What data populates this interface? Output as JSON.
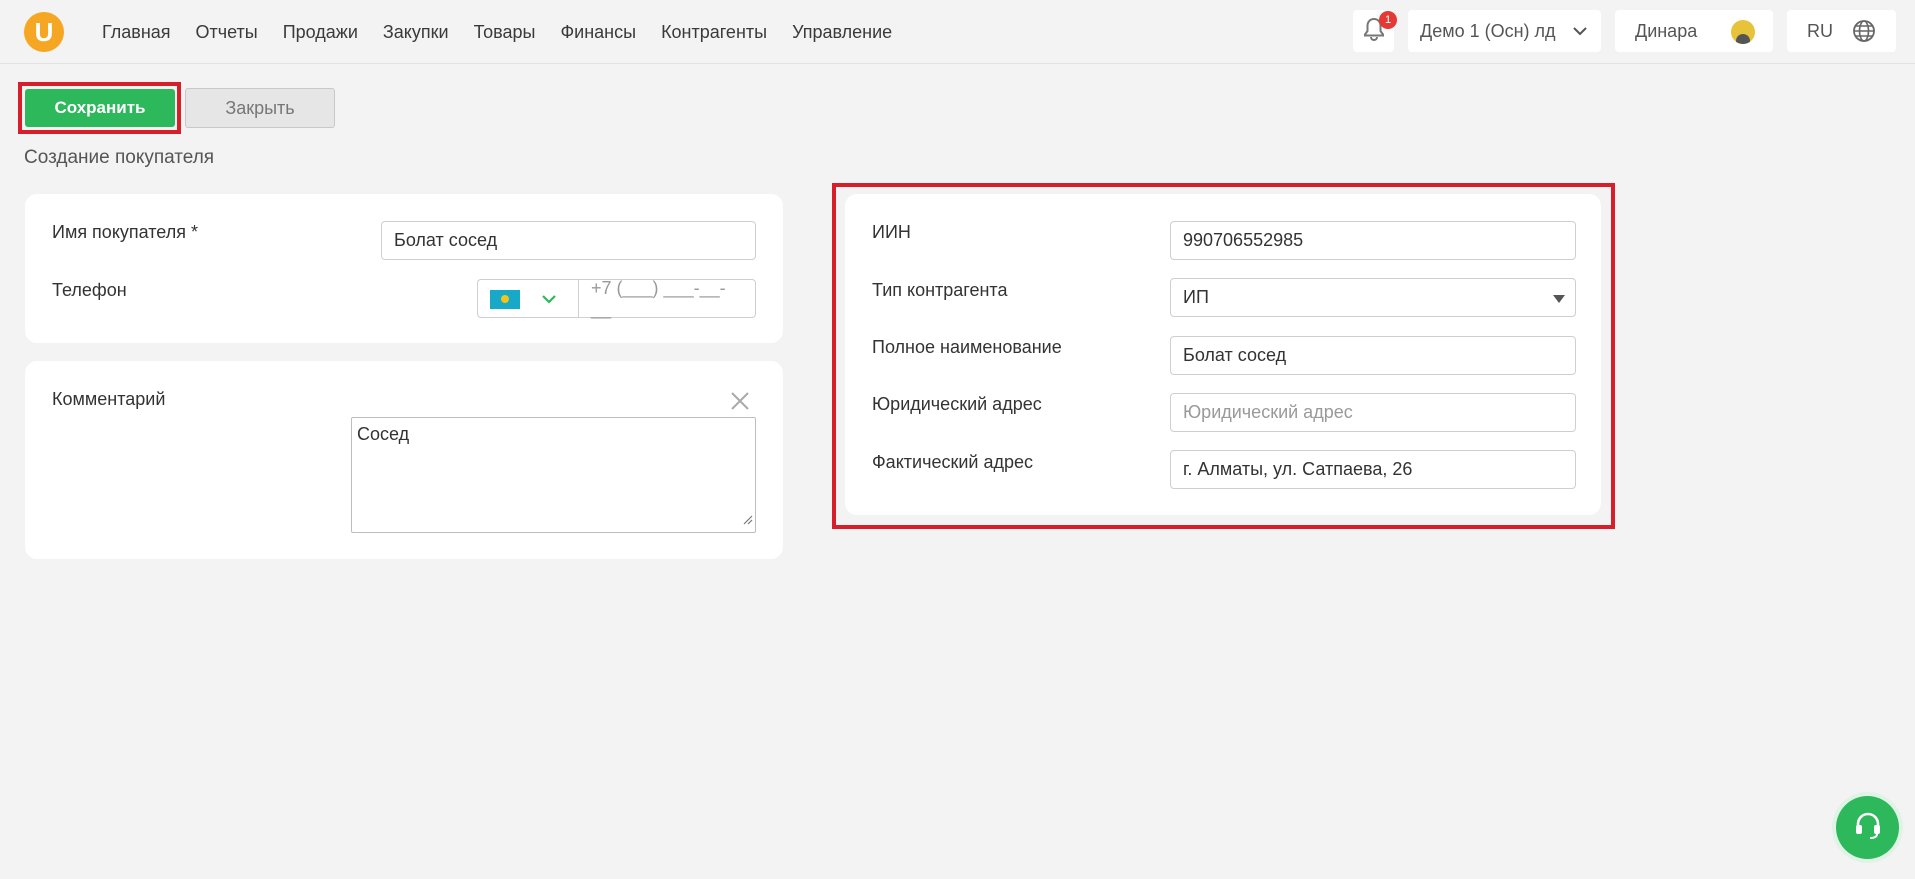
{
  "nav": {
    "logo_letter": "U",
    "items": [
      "Главная",
      "Отчеты",
      "Продажи",
      "Закупки",
      "Товары",
      "Финансы",
      "Контрагенты",
      "Управление"
    ]
  },
  "header": {
    "notifications_count": "1",
    "organization": "Демо 1 (Осн) лд",
    "user_name": "Динара",
    "language": "RU"
  },
  "toolbar": {
    "save_label": "Сохранить",
    "close_label": "Закрыть"
  },
  "page": {
    "title": "Создание покупателя"
  },
  "customer": {
    "name_label": "Имя покупателя *",
    "name_value": "Болат сосед",
    "phone_label": "Телефон",
    "phone_placeholder": "+7 (___) ___-__-__"
  },
  "comment": {
    "label": "Комментарий",
    "value": "Сосед"
  },
  "details": {
    "iin_label": "ИИН",
    "iin_value": "990706552985",
    "type_label": "Тип контрагента",
    "type_value": "ИП",
    "full_name_label": "Полное наименование",
    "full_name_value": "Болат сосед",
    "legal_address_label": "Юридический адрес",
    "legal_address_placeholder": "Юридический адрес",
    "actual_address_label": "Фактический адрес",
    "actual_address_value": "г. Алматы, ул. Сатпаева, 26"
  },
  "colors": {
    "brand": "#f5a623",
    "primary": "#2db85b",
    "highlight": "#d71f2b",
    "badge": "#e53935"
  }
}
